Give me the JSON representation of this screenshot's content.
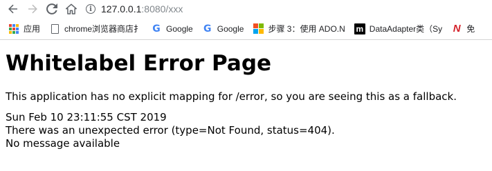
{
  "toolbar": {
    "back_icon": "arrow-left-icon",
    "forward_icon": "arrow-right-icon",
    "reload_icon": "reload-icon",
    "home_icon": "home-icon",
    "url_host": "127.0.0.1",
    "url_rest": ":8080/xxx"
  },
  "bookmarks": [
    {
      "icon": "apps-grid-icon",
      "label": "应用"
    },
    {
      "icon": "page-icon",
      "label": "chrome浏览器商店扌"
    },
    {
      "icon": "google-icon",
      "label": "Google"
    },
    {
      "icon": "google-icon",
      "label": "Google"
    },
    {
      "icon": "microsoft-icon",
      "label": "步骤 3：使用 ADO.N"
    },
    {
      "icon": "m-icon",
      "label": "DataAdapter类（Sy"
    },
    {
      "icon": "n-icon",
      "label": "免"
    }
  ],
  "page": {
    "heading": "Whitelabel Error Page",
    "message": "This application has no explicit mapping for /error, so you are seeing this as a fallback.",
    "timestamp": "Sun Feb 10 23:11:55 CST 2019",
    "error_line": "There was an unexpected error (type=Not Found, status=404).",
    "detail_line": "No message available"
  },
  "colors": {
    "google_blue": "#4285f4",
    "ms_red": "#f25022",
    "ms_green": "#7fba00",
    "ms_blue": "#00a4ef",
    "ms_yellow": "#ffb900"
  }
}
